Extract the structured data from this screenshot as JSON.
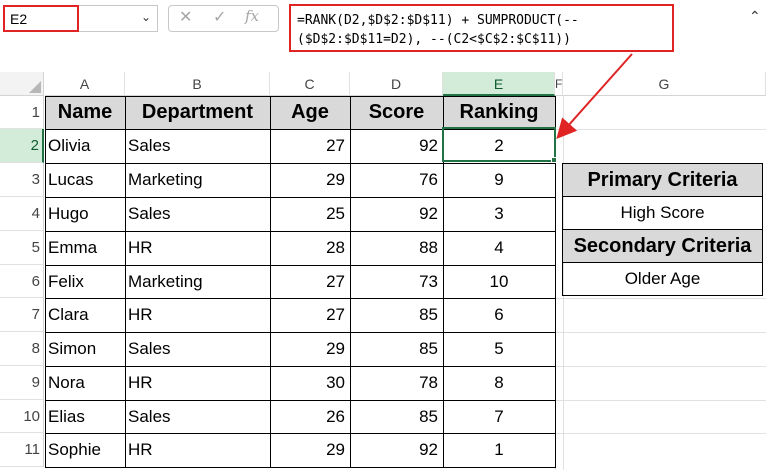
{
  "formula_bar": {
    "name_box": "E2",
    "cancel_icon": "✕",
    "enter_icon": "✓",
    "fx_icon": "fx",
    "formula": "=RANK(D2,$D$2:$D$11) + SUMPRODUCT(--\n($D$2:$D$11=D2), --(C2<$C$2:$C$11))"
  },
  "columns": [
    "A",
    "B",
    "C",
    "D",
    "E",
    "F",
    "G"
  ],
  "rows": [
    "1",
    "2",
    "3",
    "4",
    "5",
    "6",
    "7",
    "8",
    "9",
    "10",
    "11"
  ],
  "table": {
    "headers": [
      "Name",
      "Department",
      "Age",
      "Score",
      "Ranking"
    ],
    "rows": [
      [
        "Olivia",
        "Sales",
        "27",
        "92",
        "2"
      ],
      [
        "Lucas",
        "Marketing",
        "29",
        "76",
        "9"
      ],
      [
        "Hugo",
        "Sales",
        "25",
        "92",
        "3"
      ],
      [
        "Emma",
        "HR",
        "28",
        "88",
        "4"
      ],
      [
        "Felix",
        "Marketing",
        "27",
        "73",
        "10"
      ],
      [
        "Clara",
        "HR",
        "27",
        "85",
        "6"
      ],
      [
        "Simon",
        "Sales",
        "29",
        "85",
        "5"
      ],
      [
        "Nora",
        "HR",
        "30",
        "78",
        "8"
      ],
      [
        "Elias",
        "Sales",
        "26",
        "85",
        "7"
      ],
      [
        "Sophie",
        "HR",
        "29",
        "92",
        "1"
      ]
    ]
  },
  "criteria": {
    "primary_label": "Primary Criteria",
    "primary_value": "High Score",
    "secondary_label": "Secondary Criteria",
    "secondary_value": "Older Age"
  },
  "colors": {
    "highlight_red": "#e02424",
    "selection_green": "#217346",
    "header_fill": "#d9d9d9"
  }
}
